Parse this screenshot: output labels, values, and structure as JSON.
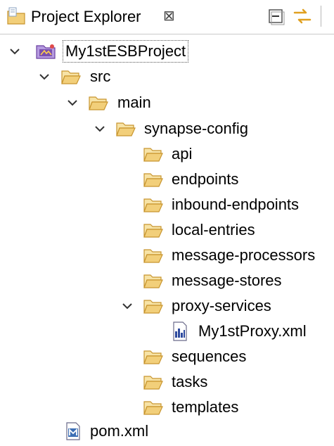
{
  "view": {
    "title": "Project Explorer",
    "close_glyph": "⊠",
    "toolbar": [
      {
        "name": "collapse-all-icon"
      },
      {
        "name": "link-with-editor-icon"
      }
    ]
  },
  "tree": {
    "project": "My1stESBProject",
    "src": "src",
    "main": "main",
    "synapse_config": "synapse-config",
    "api": "api",
    "endpoints": "endpoints",
    "inbound_endpoints": "inbound-endpoints",
    "local_entries": "local-entries",
    "message_processors": "message-processors",
    "message_stores": "message-stores",
    "proxy_services": "proxy-services",
    "proxy_file": "My1stProxy.xml",
    "sequences": "sequences",
    "tasks": "tasks",
    "templates": "templates",
    "pom": "pom.xml"
  },
  "colors": {
    "folder_fill": "#f2cf7a",
    "folder_stroke": "#c8952e",
    "chevron": "#333333",
    "project_purple": "#7a4fb0",
    "maven_blue": "#3d6fb5"
  }
}
